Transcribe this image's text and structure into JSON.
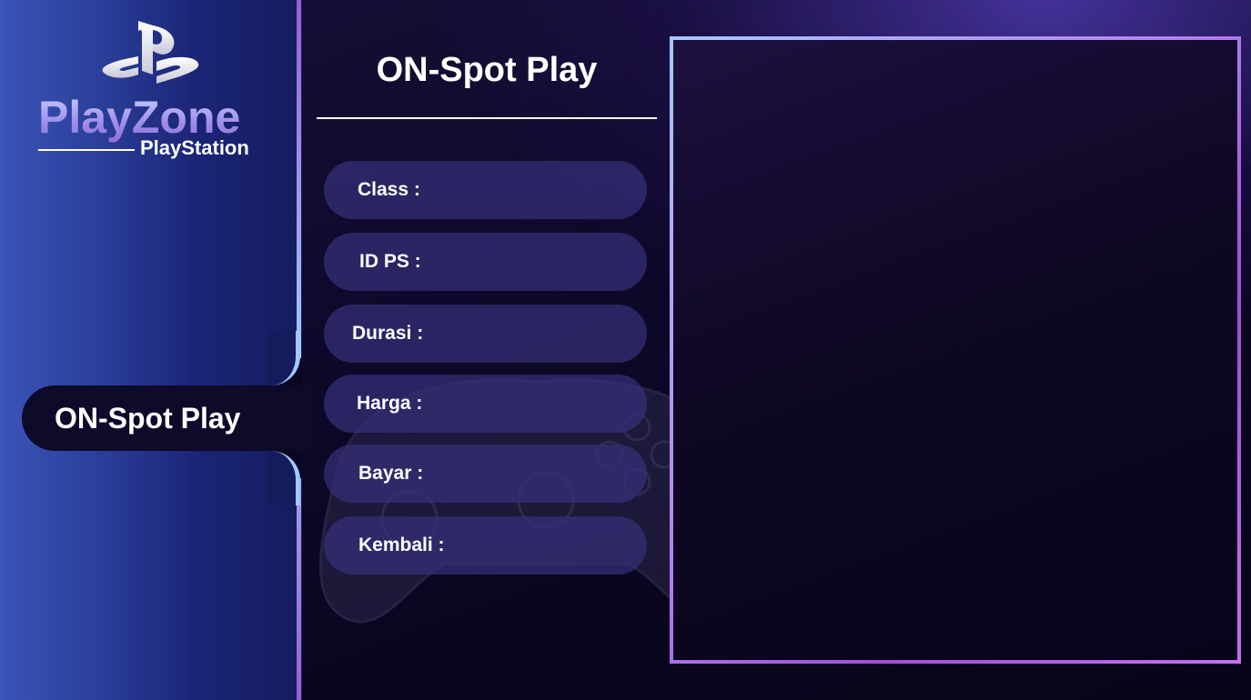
{
  "brand": {
    "name": "PlayZone",
    "subtitle": "PlayStation"
  },
  "sidebar": {
    "active_item": "ON-Spot Play"
  },
  "main": {
    "title": "ON-Spot Play",
    "fields": [
      {
        "label": "Class :"
      },
      {
        "label": "ID PS :"
      },
      {
        "label": "Durasi :"
      },
      {
        "label": "Harga :"
      },
      {
        "label": "Bayar :"
      },
      {
        "label": "Kembali :"
      }
    ]
  },
  "colors": {
    "sidebar": "#2a3d98",
    "accent_purple": "#a04fd8",
    "accent_blue": "#a8c8ff",
    "field_bg": "#343078",
    "background": "#0d0828"
  },
  "icons": {
    "logo": "playstation-logo-icon",
    "decor": "gamepad-controller-icon"
  }
}
